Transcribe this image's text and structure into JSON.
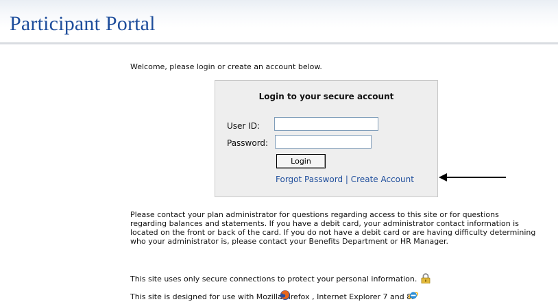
{
  "header": {
    "title": "Participant Portal"
  },
  "welcome_text": "Welcome, please login or create an account below.",
  "login_box": {
    "heading": "Login to your secure account",
    "userid_label": "User ID:",
    "userid_value": "",
    "password_label": "Password:",
    "password_value": "",
    "login_button": "Login",
    "forgot_password_link": "Forgot Password",
    "separator": "|",
    "create_account_link": "Create Account"
  },
  "info_paragraph": "Please contact your plan administrator for questions regarding access to this site or for questions regarding balances and statements. If you have a debit card, your administrator contact information is located on the front or back of the card. If you do not have a debit card or are having difficulty determining who your administrator is, please contact your Benefits Department or HR Manager.",
  "secure_connection_text": "This site uses only secure connections to protect your personal information.",
  "browser_support_text": "This site is designed for use with Mozilla Firefox , Internet Explorer 7 and 8.",
  "icons": {
    "padlock": "padlock-icon",
    "firefox": "firefox-icon",
    "internet_explorer": "internet-explorer-icon",
    "annotation_arrow": "arrow-left-icon"
  },
  "colors": {
    "title_blue": "#1f4e9c",
    "link_blue": "#1f4e9c",
    "login_box_bg": "#eeeeee"
  }
}
